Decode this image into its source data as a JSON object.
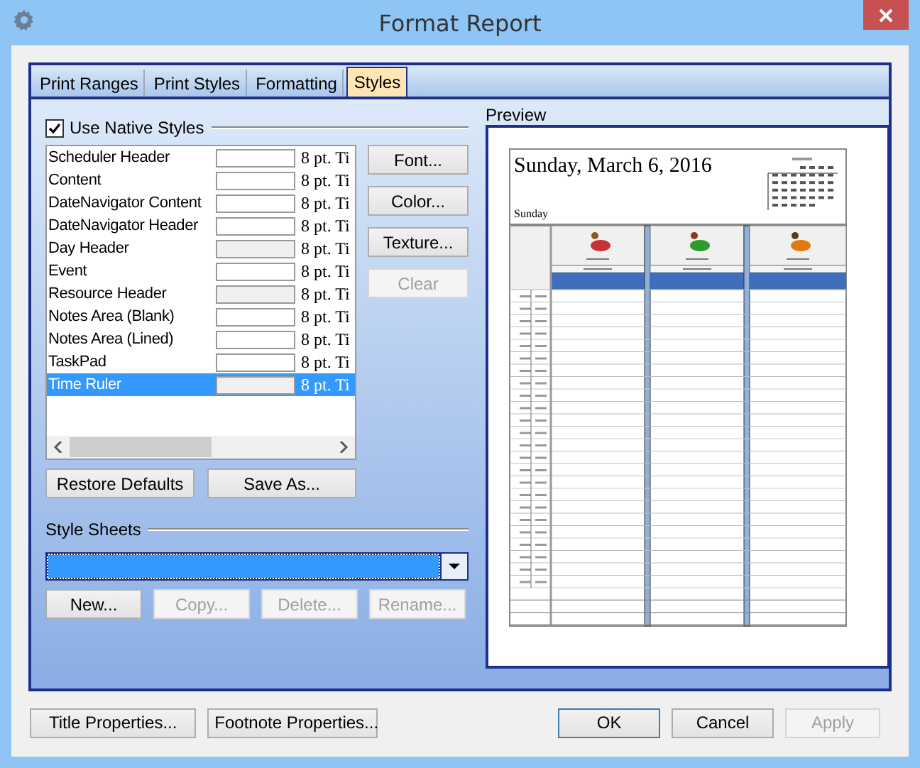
{
  "window": {
    "title": "Format Report"
  },
  "tabs": [
    {
      "label": "Print Ranges",
      "selected": false
    },
    {
      "label": "Print Styles",
      "selected": false
    },
    {
      "label": "Formatting",
      "selected": false
    },
    {
      "label": "Styles",
      "selected": true
    }
  ],
  "use_native_styles": {
    "label": "Use Native Styles",
    "checked": true
  },
  "styles": [
    {
      "name": "Scheduler Header",
      "color": "#ffffff",
      "font": "8 pt. Ti",
      "selected": false
    },
    {
      "name": "Content",
      "color": "#ffffff",
      "font": "8 pt. Ti",
      "selected": false
    },
    {
      "name": "DateNavigator Content",
      "color": "#ffffff",
      "font": "8 pt. Ti",
      "selected": false
    },
    {
      "name": "DateNavigator Header",
      "color": "#ffffff",
      "font": "8 pt. Ti",
      "selected": false
    },
    {
      "name": "Day Header",
      "color": "#f0f0f0",
      "font": "8 pt. Ti",
      "selected": false
    },
    {
      "name": "Event",
      "color": "#ffffff",
      "font": "8 pt. Ti",
      "selected": false
    },
    {
      "name": "Resource Header",
      "color": "#f0f0f0",
      "font": "8 pt. Ti",
      "selected": false
    },
    {
      "name": "Notes Area (Blank)",
      "color": "#ffffff",
      "font": "8 pt. Ti",
      "selected": false
    },
    {
      "name": "Notes Area (Lined)",
      "color": "#ffffff",
      "font": "8 pt. Ti",
      "selected": false
    },
    {
      "name": "TaskPad",
      "color": "#ffffff",
      "font": "8 pt. Ti",
      "selected": false
    },
    {
      "name": "Time Ruler",
      "color": "#f0f0f0",
      "font": "8 pt. Ti",
      "selected": true
    }
  ],
  "style_buttons": [
    {
      "label": "Font...",
      "disabled": false
    },
    {
      "label": "Color...",
      "disabled": false
    },
    {
      "label": "Texture...",
      "disabled": false
    },
    {
      "label": "Clear",
      "disabled": true
    }
  ],
  "list_buttons": [
    {
      "label": "Restore Defaults",
      "disabled": false
    },
    {
      "label": "Save As...",
      "disabled": false
    }
  ],
  "style_sheets": {
    "label": "Style Sheets",
    "selected": true
  },
  "sheet_buttons": [
    {
      "label": "New...",
      "disabled": false
    },
    {
      "label": "Copy...",
      "disabled": true
    },
    {
      "label": "Delete...",
      "disabled": true
    },
    {
      "label": "Rename...",
      "disabled": true
    }
  ],
  "preview": {
    "label": "Preview",
    "date": "Sunday, March 6, 2016",
    "day": "Sunday"
  },
  "footer_buttons": [
    {
      "label": "Title Properties...",
      "disabled": false,
      "default": false
    },
    {
      "label": "Footnote Properties...",
      "disabled": false,
      "default": false
    },
    {
      "label": "OK",
      "disabled": false,
      "default": true
    },
    {
      "label": "Cancel",
      "disabled": false,
      "default": false
    },
    {
      "label": "Apply",
      "disabled": true,
      "default": false
    }
  ]
}
